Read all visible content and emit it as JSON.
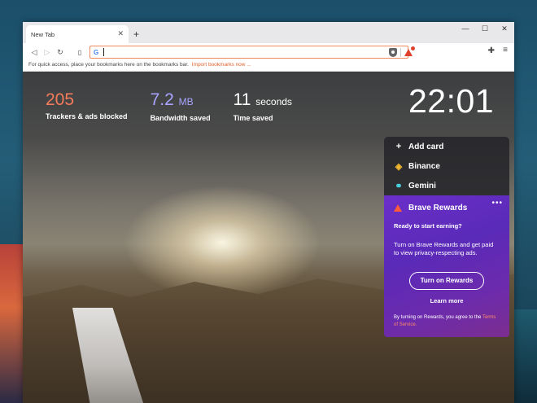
{
  "browser": {
    "tab_title": "New Tab",
    "tab_close": "✕",
    "new_tab": "+",
    "window_controls": {
      "minimize": "—",
      "maximize": "☐",
      "close": "✕"
    },
    "address_value": "",
    "search_engine_badge": "G",
    "bookmarks_bar": {
      "message": "For quick access, place your bookmarks here on the bookmarks bar.",
      "link": "Import bookmarks now ..."
    }
  },
  "stats": [
    {
      "value": "205",
      "unit": "",
      "label": "Trackers & ads blocked",
      "color": "#f57c5a"
    },
    {
      "value": "7.2",
      "unit": "MB",
      "label": "Bandwidth saved",
      "color": "#a9a4ff"
    },
    {
      "value": "11",
      "unit": "seconds",
      "label": "Time saved",
      "color": "#ffffff"
    }
  ],
  "clock": "22:01",
  "widgets": {
    "add_card": "Add card",
    "binance": "Binance",
    "gemini": "Gemini"
  },
  "rewards": {
    "title": "Brave Rewards",
    "more": "•••",
    "question": "Ready to start earning?",
    "description": "Turn on Brave Rewards and get paid to view privacy-respecting ads.",
    "button": "Turn on Rewards",
    "learn_more": "Learn more",
    "footer_prefix": "By turning on Rewards, you agree to the",
    "footer_link": "Terms of Service."
  },
  "icons": {
    "back": "back-arrow-icon",
    "forward": "forward-arrow-icon",
    "reload": "reload-icon",
    "bookmark": "bookmark-icon",
    "shield": "brave-shield-icon",
    "rewards": "brave-rewards-icon",
    "extensions": "puzzle-icon",
    "menu": "menu-icon",
    "add": "plus-icon",
    "binance": "binance-icon",
    "gemini": "gemini-icon"
  }
}
